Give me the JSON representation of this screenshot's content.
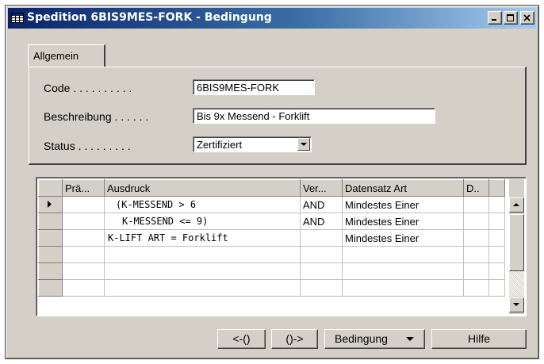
{
  "window": {
    "title": "Spedition 6BIS9MES-FORK - Bedingung",
    "controls": [
      "minimize",
      "maximize",
      "close"
    ]
  },
  "tabs": [
    {
      "label": "Allgemein",
      "active": true
    }
  ],
  "form": {
    "code": {
      "label": "Code . . . . . . . . . .",
      "value": "6BIS9MES-FORK"
    },
    "beschreibung": {
      "label": "Beschreibung . . . . . .",
      "value": "Bis 9x Messend - Forklift"
    },
    "status": {
      "label": "Status . . . . . . . . .",
      "value": "Zertifiziert"
    }
  },
  "table": {
    "columns": [
      "Prä...",
      "Ausdruck",
      "Ver...",
      "Datensatz Art",
      "D.."
    ],
    "rows": [
      {
        "prae": "",
        "ausdruck": "(K-MESSEND > 6",
        "ver": "AND",
        "art": "Mindestes Einer",
        "d": "",
        "current": true
      },
      {
        "prae": "",
        "ausdruck": "K-MESSEND <= 9)",
        "ver": "AND",
        "art": "Mindestes Einer",
        "d": "",
        "current": false
      },
      {
        "prae": "",
        "ausdruck": "K-LIFT ART = Forklift",
        "ver": "",
        "art": "Mindestes Einer",
        "d": "",
        "current": false
      },
      {
        "prae": "",
        "ausdruck": "",
        "ver": "",
        "art": "",
        "d": "",
        "current": false
      },
      {
        "prae": "",
        "ausdruck": "",
        "ver": "",
        "art": "",
        "d": "",
        "current": false
      },
      {
        "prae": "",
        "ausdruck": "",
        "ver": "",
        "art": "",
        "d": "",
        "current": false
      }
    ]
  },
  "buttons": {
    "left": "<-()",
    "right": "()->",
    "bedingung": "Bedingung",
    "hilfe": "Hilfe"
  }
}
